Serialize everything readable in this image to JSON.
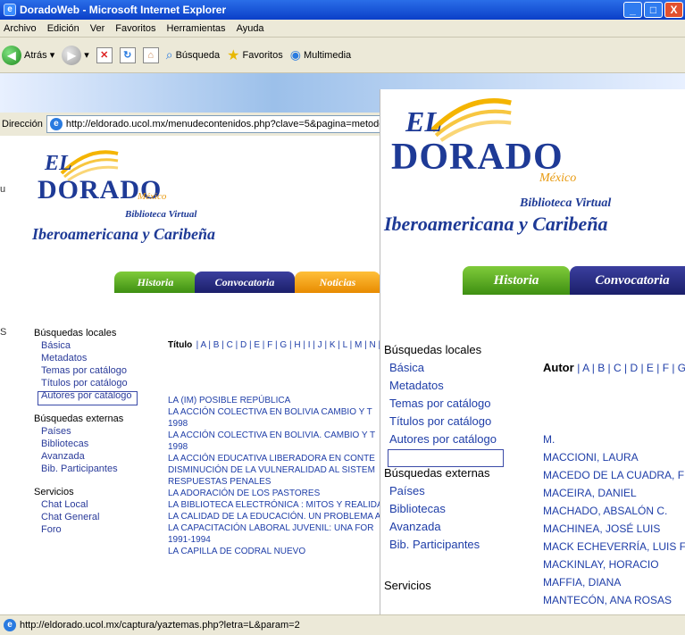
{
  "window": {
    "title": "DoradoWeb - Microsoft Internet Explorer",
    "btn_min": "_",
    "btn_max": "□",
    "btn_close": "X"
  },
  "menu": [
    "Archivo",
    "Edición",
    "Ver",
    "Favoritos",
    "Herramientas",
    "Ayuda"
  ],
  "toolbar": {
    "back": "Atrás",
    "search": "Búsqueda",
    "favorites": "Favoritos",
    "media": "Multimedia"
  },
  "address": {
    "label": "Dirección",
    "url": "http://eldorado.ucol.mx/menudecontenidos.php?clave=5&pagina=metodo"
  },
  "status": {
    "url": "http://eldorado.ucol.mx/captura/yaztemas.php?letra=L&param=2"
  },
  "logo": {
    "el": "EL",
    "dorado": "DORADO",
    "mexico": "México",
    "biblioteca": "Biblioteca Virtual",
    "iber": "Iberoamericana y Caribeña"
  },
  "tabs": [
    "Historia",
    "Convocatoria",
    "Noticias"
  ],
  "sidebar": {
    "locales_header": "Búsquedas locales",
    "locales": [
      "Básica",
      "Metadatos",
      "Temas por catálogo",
      "Títulos por catálogo",
      "Autores por catálogo"
    ],
    "externas_header": "Búsquedas externas",
    "externas": [
      "Países",
      "Bibliotecas",
      "Avanzada",
      "Bib. Participantes"
    ],
    "servicios_header": "Servicios",
    "servicios": [
      "Chat Local",
      "Chat General",
      "Foro"
    ]
  },
  "titulos": {
    "header_label": "Título",
    "letters": "| A | B | C | D | E | F | G | H | I | J | K | L | M | N |",
    "items": [
      "LA (IM) POSIBLE REPÚBLICA",
      "LA ACCIÓN COLECTIVA EN BOLIVIA CAMBIO Y T",
      "1998",
      "LA ACCIÓN COLECTIVA EN BOLIVIA. CAMBIO Y T",
      "1998",
      "LA ACCIÓN EDUCATIVA LIBERADORA EN CONTE",
      "DISMINUCIÓN DE LA VULNERALIDAD AL SISTEM",
      "RESPUESTAS PENALES",
      "LA ADORACIÓN DE LOS PASTORES",
      "LA BIBLIOTECA ELECTRÓNICA : MITOS Y REALIDA",
      "LA CALIDAD DE LA EDUCACIÓN. UN PROBLEMA A",
      "LA CAPACITACIÓN LABORAL JUVENIL: UNA FOR",
      "1991-1994",
      "LA CAPILLA DE CODRAL NUEVO"
    ]
  },
  "autores": {
    "header_label": "Autor",
    "letters": "| A | B | C | D | E | F | G",
    "items": [
      "M.",
      "MACCIONI, LAURA",
      "MACEDO DE LA CUADRA, F",
      "MACEIRA, DANIEL",
      "MACHADO, ABSALÓN C.",
      "MACHINEA, JOSÉ LUIS",
      "MACK ECHEVERRÍA, LUIS FE",
      "MACKINLAY, HORACIO",
      "MAFFIA, DIANA",
      "MANTECÓN, ANA ROSAS"
    ]
  },
  "overlay_sidebar": {
    "locales_header": "Búsquedas locales",
    "locales": [
      "Básica",
      "Metadatos",
      "Temas por catálogo",
      "Títulos por catálogo",
      "Autores por catálogo"
    ],
    "externas_header": "Búsquedas externas",
    "externas": [
      "Países",
      "Bibliotecas",
      "Avanzada",
      "Bib. Participantes"
    ],
    "servicios_header": "Servicios"
  },
  "fragments": {
    "left_top": "u",
    "left_mid": "S"
  }
}
